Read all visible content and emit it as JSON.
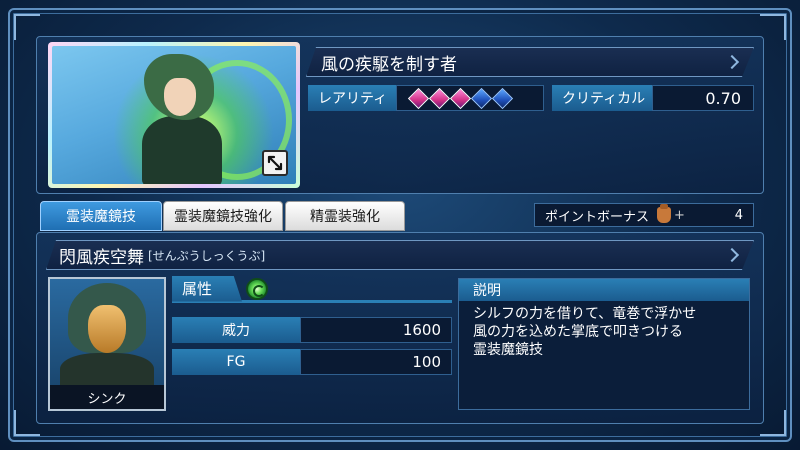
{
  "skill": {
    "title": "風の疾駆を制す者",
    "rarity_label": "レアリティ",
    "rarity": {
      "filled": 3,
      "total": 5
    },
    "critical_label": "クリティカル",
    "critical_value": "0.70"
  },
  "tabs": [
    {
      "label": "霊装魔鏡技",
      "active": true
    },
    {
      "label": "霊装魔鏡技強化",
      "active": false
    },
    {
      "label": "精霊装強化",
      "active": false
    }
  ],
  "point_bonus": {
    "label": "ポイントボーナス",
    "plus": "+",
    "value": "4"
  },
  "technique": {
    "name": "閃風疾空舞",
    "reading": "[せんぷうしっくうぶ]",
    "attribute_label": "属性",
    "attribute_icon": "wind-attribute-icon",
    "power_label": "威力",
    "power_value": "1600",
    "fg_label": "FG",
    "fg_value": "100",
    "description_label": "説明",
    "description_lines": [
      "シルフの力を借りて、竜巻で浮かせ",
      "風の力を込めた掌底で叩きつける",
      "霊装魔鏡技"
    ]
  },
  "character": {
    "name": "シンク"
  },
  "colors": {
    "accent": "#2a7fb5",
    "gem_filled": "#d12f86",
    "gem_empty": "#1e4fb8",
    "tab_active": "#3f9ae0"
  }
}
